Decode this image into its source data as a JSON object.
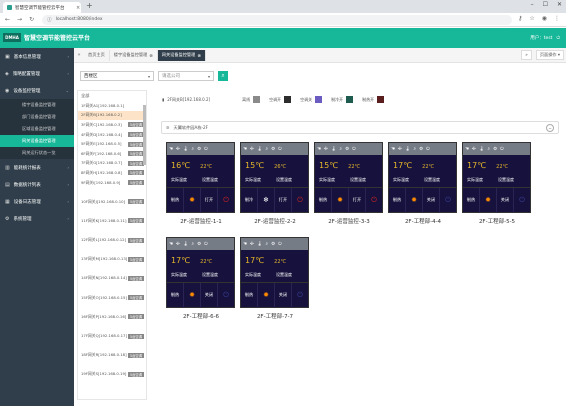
{
  "browser": {
    "tab_title": "智慧空调节能管控云平台",
    "url": "localhost:8080/index",
    "tab_close": "×",
    "new_tab": "+"
  },
  "header": {
    "logo_text": "DMHA",
    "app_title": "智慧空调节能管控云平台",
    "user_text": "用户：test",
    "logout": "⏻"
  },
  "sidebar": {
    "items": [
      {
        "label": "基本信息管理",
        "icon": "▣"
      },
      {
        "label": "策略配置管理",
        "icon": "◈"
      },
      {
        "label": "设备监控管理",
        "icon": "◉"
      }
    ],
    "sub_items": [
      {
        "label": "楼宇设备监控管理",
        "active": false
      },
      {
        "label": "部门设备监控管理",
        "active": false
      },
      {
        "label": "区域设备监控管理",
        "active": false
      },
      {
        "label": "网关设备监控管理",
        "active": true
      },
      {
        "label": "网关运行状态一览",
        "active": false
      }
    ],
    "items2": [
      {
        "label": "能耗统计报表",
        "icon": "▥"
      },
      {
        "label": "数据统计列表",
        "icon": "▤"
      },
      {
        "label": "设备日志管理",
        "icon": "▦"
      },
      {
        "label": "系统管理",
        "icon": "⚙"
      }
    ]
  },
  "page_tabs": {
    "items": [
      {
        "label": "首页主页",
        "active": false
      },
      {
        "label": "楼宇设备监控管理",
        "active": false
      },
      {
        "label": "网关设备监控管理",
        "active": true
      }
    ],
    "right_buttons": [
      "»",
      "页面操作 ▾"
    ]
  },
  "filter": {
    "region": "西楼区",
    "company": "请选公司",
    "search_icon": "🔍"
  },
  "device_list": {
    "header": "全部",
    "items": [
      {
        "label": "1F网关A1[192.168.0.1]",
        "tag": "",
        "selected": false
      },
      {
        "label": "2F网关B[192.168.0.2]",
        "tag": "",
        "selected": true
      },
      {
        "label": "3F网关C[192.168.0.3]",
        "tag": "5台空调",
        "selected": false
      },
      {
        "label": "4F网关D[192.168.0.4]",
        "tag": "5台空调",
        "selected": false
      },
      {
        "label": "5F网关E[192.168.0.5]",
        "tag": "5台空调",
        "selected": false
      },
      {
        "label": "6F网关F[192.168.0.6]",
        "tag": "5台空调",
        "selected": false
      },
      {
        "label": "7F网关G[192.168.0.7]",
        "tag": "5台空调",
        "selected": false
      },
      {
        "label": "8F网关H[192.168.0.8]",
        "tag": "5台空调",
        "selected": false
      },
      {
        "label": "9F网关I[192.168.0.9]",
        "tag": "5台空调",
        "selected": false
      },
      {
        "label": "",
        "tag": "",
        "selected": false
      },
      {
        "label": "10F网关J[192.168.0.10]",
        "tag": "5台空调",
        "selected": false
      },
      {
        "label": "",
        "tag": "",
        "selected": false
      },
      {
        "label": "11F网关K[192.168.0.11]",
        "tag": "5台空调",
        "selected": false
      },
      {
        "label": "",
        "tag": "",
        "selected": false
      },
      {
        "label": "12F网关L[192.168.0.12]",
        "tag": "5台空调",
        "selected": false
      },
      {
        "label": "",
        "tag": "",
        "selected": false
      },
      {
        "label": "13F网关M[192.168.0.13]",
        "tag": "5台空调",
        "selected": false
      },
      {
        "label": "",
        "tag": "",
        "selected": false
      },
      {
        "label": "14F网关N[192.168.0.14]",
        "tag": "5台空调",
        "selected": false
      },
      {
        "label": "",
        "tag": "",
        "selected": false
      },
      {
        "label": "15F网关O[192.168.0.15]",
        "tag": "5台空调",
        "selected": false
      },
      {
        "label": "",
        "tag": "",
        "selected": false
      },
      {
        "label": "16F网关P[192.168.0.16]",
        "tag": "5台空调",
        "selected": false
      },
      {
        "label": "",
        "tag": "",
        "selected": false
      },
      {
        "label": "17F网关Q[192.168.0.17]",
        "tag": "5台空调",
        "selected": false
      },
      {
        "label": "",
        "tag": "",
        "selected": false
      },
      {
        "label": "18F网关R[192.168.0.18]",
        "tag": "5台空调",
        "selected": false
      },
      {
        "label": "",
        "tag": "",
        "selected": false
      },
      {
        "label": "19F网关S[192.168.0.19]",
        "tag": "5台空调",
        "selected": false
      }
    ]
  },
  "legend": {
    "gateway": "2F网关B[192.168.0.2]",
    "items": [
      {
        "label": "离线",
        "color": "#8a8a8a"
      },
      {
        "label": "空调开",
        "color": "#2d2d2d"
      },
      {
        "label": "空调关",
        "color": "#6a5cc0"
      },
      {
        "label": "制冷开",
        "color": "#1e5c4f"
      },
      {
        "label": "制热开",
        "color": "#5a1e1e"
      }
    ]
  },
  "zone": {
    "title": "天翼软件园A栋-2F",
    "collapse": "−"
  },
  "cards": [
    {
      "name": "2F-运营监控-1-1",
      "actual": "16℃",
      "setting": "22℃",
      "mode": "制热",
      "mode_icon": "sun",
      "power": "打开",
      "on": true
    },
    {
      "name": "2F-运营监控-2-2",
      "actual": "15℃",
      "setting": "26℃",
      "mode": "制冷",
      "mode_icon": "snow",
      "power": "打开",
      "on": true
    },
    {
      "name": "2F-运营监控-3-3",
      "actual": "15℃",
      "setting": "22℃",
      "mode": "制热",
      "mode_icon": "sun",
      "power": "打开",
      "on": true
    },
    {
      "name": "2F-工程部-4-4",
      "actual": "17℃",
      "setting": "22℃",
      "mode": "制热",
      "mode_icon": "sun",
      "power": "关闭",
      "on": false
    },
    {
      "name": "2F-工程部-5-5",
      "actual": "17℃",
      "setting": "22℃",
      "mode": "制热",
      "mode_icon": "sun",
      "power": "关闭",
      "on": false
    },
    {
      "name": "2F-工程部-6-6",
      "actual": "17℃",
      "setting": "22℃",
      "mode": "制热",
      "mode_icon": "sun",
      "power": "关闭",
      "on": false
    },
    {
      "name": "2F-工程部-7-7",
      "actual": "17℃",
      "setting": "22℃",
      "mode": "制热",
      "mode_icon": "sun",
      "power": "关闭",
      "on": false
    }
  ],
  "card_labels": {
    "actual": "实际温度",
    "setting": "设置温度"
  }
}
